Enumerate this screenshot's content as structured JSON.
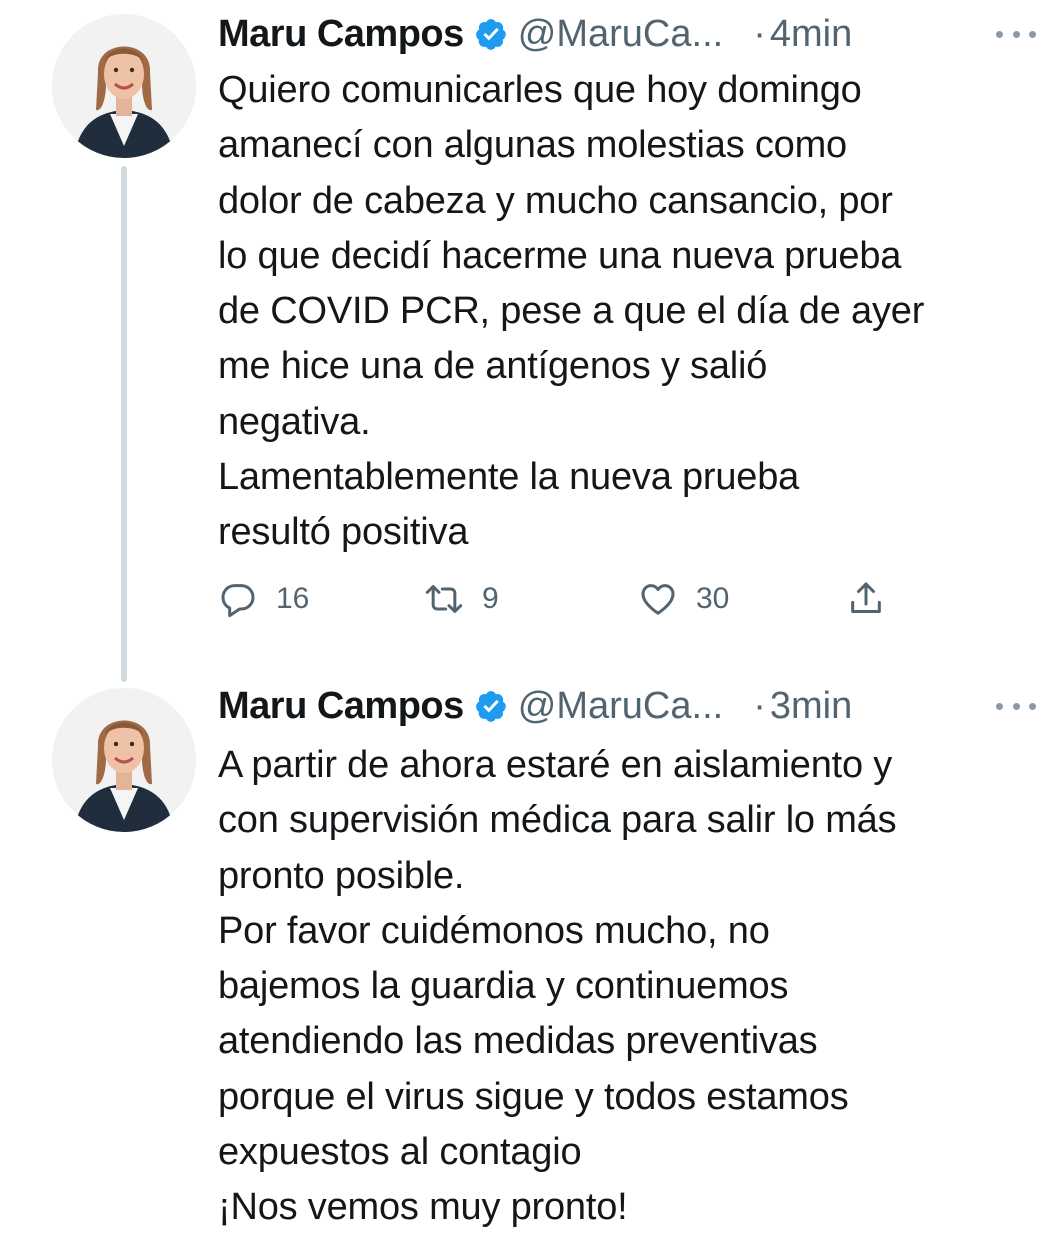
{
  "tweets": [
    {
      "author_name": "Maru Campos",
      "author_handle": "@MaruCa...",
      "separator": "·",
      "time": "4min",
      "lines": [
        "Quiero comunicarles que hoy domingo",
        "amanecí con algunas molestias como",
        "dolor de cabeza y mucho cansancio, por",
        "lo que decidí hacerme una nueva prueba",
        "de COVID PCR, pese a que el día de ayer",
        "me hice una de antígenos y salió",
        "negativa.",
        "Lamentablemente la nueva prueba",
        "resultó positiva"
      ],
      "replies": "16",
      "retweets": "9",
      "likes": "30"
    },
    {
      "author_name": "Maru Campos",
      "author_handle": "@MaruCa...",
      "separator": "·",
      "time": "3min",
      "lines": [
        "A partir de ahora estaré en aislamiento y",
        "con supervisión médica para salir lo más",
        "pronto posible.",
        "Por favor cuidémonos mucho, no",
        "bajemos la guardia y continuemos",
        "atendiendo las medidas preventivas",
        "porque el virus sigue y todos estamos",
        "expuestos al contagio",
        "¡Nos vemos muy pronto!"
      ]
    }
  ],
  "icons": {
    "verified": "verified-badge-icon",
    "more": "more-options-icon",
    "reply": "reply-icon",
    "retweet": "retweet-icon",
    "like": "like-icon",
    "share": "share-icon"
  },
  "colors": {
    "verified_blue": "#1d9bf0",
    "secondary_text": "#536471",
    "thread_line": "#cfd9de"
  }
}
